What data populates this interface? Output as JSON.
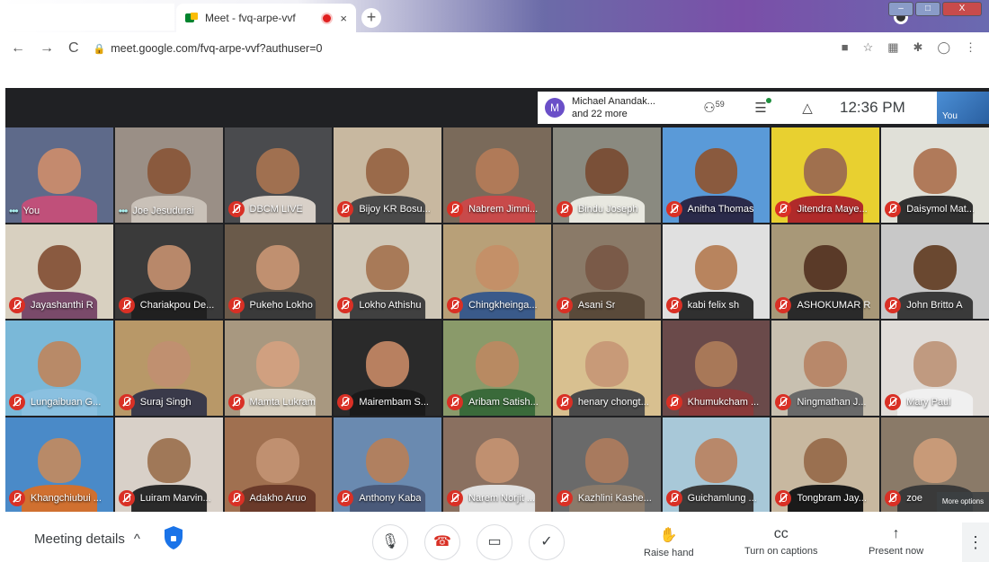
{
  "browser": {
    "tab_title": "Meet - fvq-arpe-vvf",
    "tab_close": "×",
    "new_tab": "+",
    "url": "meet.google.com/fvq-arpe-vvf?authuser=0",
    "nav_back": "←",
    "nav_forward": "→",
    "nav_reload": "C",
    "lock": "🔒",
    "window_controls": [
      "–",
      "□",
      "X"
    ]
  },
  "topbar": {
    "presenter_initial": "M",
    "presenter_name": "Michael Anandak...",
    "presenter_more": "and 22 more",
    "participants_count": "59",
    "time": "12:36 PM",
    "self_label": "You"
  },
  "participants": [
    {
      "name": "You",
      "muted": false,
      "bg": "#5e6a8a",
      "skin": "#c48a6e",
      "shirt": "#c0507a"
    },
    {
      "name": "Joe Jesudurai",
      "muted": false,
      "bg": "#9a8f86",
      "skin": "#8a5a3e",
      "shirt": "#c9c1b8"
    },
    {
      "name": "DBCM LIVE",
      "muted": true,
      "bg": "#4a4b4e",
      "skin": "#a07050",
      "shirt": "#d8d0c8"
    },
    {
      "name": "Bijoy KR Bosu...",
      "muted": true,
      "bg": "#c8b8a0",
      "skin": "#9a6a4a",
      "shirt": "#4a4a4a"
    },
    {
      "name": "Nabrem Jimni...",
      "muted": true,
      "bg": "#7a6a5a",
      "skin": "#b07a58",
      "shirt": "#c84a4a"
    },
    {
      "name": "Bindu Joseph",
      "muted": true,
      "bg": "#8a8a80",
      "skin": "#7a5038",
      "shirt": "#e8e8e0"
    },
    {
      "name": "Anitha Thomas",
      "muted": true,
      "bg": "#5a9ad8",
      "skin": "#8a5a3e",
      "shirt": "#2a2a4a"
    },
    {
      "name": "Jitendra Maye...",
      "muted": true,
      "bg": "#e8d030",
      "skin": "#a0704e",
      "shirt": "#b02a2a"
    },
    {
      "name": "Daisymol Mat...",
      "muted": true,
      "bg": "#e0e0d8",
      "skin": "#b07a5a",
      "shirt": "#303030"
    },
    {
      "name": "Jayashanthi R",
      "muted": true,
      "bg": "#d8d0c0",
      "skin": "#8a5a40",
      "shirt": "#7a4a6a"
    },
    {
      "name": "Chariakpou De...",
      "muted": true,
      "bg": "#3a3a3a",
      "skin": "#b8886a",
      "shirt": "#202020"
    },
    {
      "name": "Pukeho Lokho",
      "muted": true,
      "bg": "#6a5a4a",
      "skin": "#c09070",
      "shirt": "#3a3a3a"
    },
    {
      "name": "Lokho Athishu",
      "muted": true,
      "bg": "#d0c8b8",
      "skin": "#a87a58",
      "shirt": "#404040"
    },
    {
      "name": "Chingkheinga...",
      "muted": true,
      "bg": "#b8a078",
      "skin": "#c49068",
      "shirt": "#3a5a8a"
    },
    {
      "name": "Asani Sr",
      "muted": true,
      "bg": "#8a7a68",
      "skin": "#7a5a48",
      "shirt": "#5a4a3a"
    },
    {
      "name": "kabi felix sh",
      "muted": true,
      "bg": "#e0e0e0",
      "skin": "#b8845e",
      "shirt": "#303030"
    },
    {
      "name": "ASHOKUMAR R",
      "muted": true,
      "bg": "#a89878",
      "skin": "#5a3a28",
      "shirt": "#2a2a2a"
    },
    {
      "name": "John Britto A",
      "muted": true,
      "bg": "#c8c8c8",
      "skin": "#6a4830",
      "shirt": "#3a3a3a"
    },
    {
      "name": "Lungaibuan G...",
      "muted": true,
      "bg": "#7ab8d8",
      "skin": "#b88a68",
      "shirt": "#8ac0e0"
    },
    {
      "name": "Suraj Singh",
      "muted": true,
      "bg": "#b89868",
      "skin": "#c09070",
      "shirt": "#3a3a4a"
    },
    {
      "name": "Mamta Lukram",
      "muted": true,
      "bg": "#a89880",
      "skin": "#d0a080",
      "shirt": "#d8d0c0"
    },
    {
      "name": "Mairembam S...",
      "muted": true,
      "bg": "#2a2a2a",
      "skin": "#b88060",
      "shirt": "#1a1a1a"
    },
    {
      "name": "Aribam Satish...",
      "muted": true,
      "bg": "#8a9a6a",
      "skin": "#b88a62",
      "shirt": "#3a6a3a"
    },
    {
      "name": "henary chongt...",
      "muted": true,
      "bg": "#d8c090",
      "skin": "#c89a78",
      "shirt": "#4a4a4a"
    },
    {
      "name": "Khumukcham ...",
      "muted": true,
      "bg": "#6a4a4a",
      "skin": "#a87858",
      "shirt": "#8a3a3a"
    },
    {
      "name": "Ningmathan J...",
      "muted": true,
      "bg": "#c8c0b0",
      "skin": "#b8886a",
      "shirt": "#6a6a6a"
    },
    {
      "name": "Mary Paul",
      "muted": true,
      "bg": "#e0dcd8",
      "skin": "#c09a80",
      "shirt": "#f0f0f0"
    },
    {
      "name": "Khangchiubui ...",
      "muted": true,
      "bg": "#4a8ac8",
      "skin": "#b88a68",
      "shirt": "#d07030"
    },
    {
      "name": "Luiram Marvin...",
      "muted": true,
      "bg": "#d8d0c8",
      "skin": "#a07858",
      "shirt": "#2a2a2a"
    },
    {
      "name": "Adakho Aruo",
      "muted": true,
      "bg": "#a07050",
      "skin": "#c09070",
      "shirt": "#6a3a2a"
    },
    {
      "name": "Anthony Kaba",
      "muted": true,
      "bg": "#6a8ab0",
      "skin": "#b08060",
      "shirt": "#4a5a7a"
    },
    {
      "name": "Narem Norjit ...",
      "muted": true,
      "bg": "#8a7060",
      "skin": "#c09070",
      "shirt": "#e0e0e0"
    },
    {
      "name": "Kazhlini Kashe...",
      "muted": true,
      "bg": "#6a6a6a",
      "skin": "#a87a5e",
      "shirt": "#8a7a6a"
    },
    {
      "name": "Guichamlung ...",
      "muted": true,
      "bg": "#a8c8d8",
      "skin": "#b8886a",
      "shirt": "#3a3a3a"
    },
    {
      "name": "Tongbram Jay...",
      "muted": true,
      "bg": "#c8b8a0",
      "skin": "#9a7050",
      "shirt": "#1a1a1a"
    },
    {
      "name": "zoe",
      "muted": true,
      "bg": "#8a7a68",
      "skin": "#c89a78",
      "shirt": "#3a3a3a"
    }
  ],
  "more_options": "More options",
  "bottom": {
    "meeting_details": "Meeting details",
    "chevron": "^",
    "raise_hand": "Raise hand",
    "captions": "Turn on captions",
    "present": "Present now",
    "cc_icon": "cc",
    "present_icon": "↑",
    "mic_icon": "🎙",
    "hang_icon": "☎",
    "cam_icon": "▭",
    "check_icon": "✓",
    "kebab": "⋮",
    "hand_icon": "✋"
  }
}
